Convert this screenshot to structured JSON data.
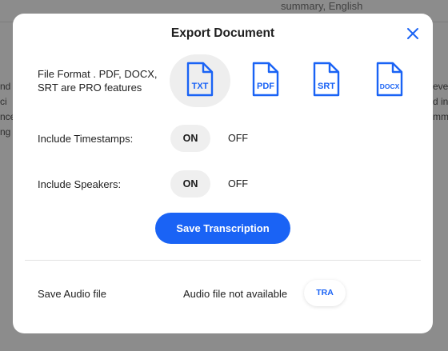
{
  "background": {
    "topbar_text": "summary, English",
    "fragments_left": [
      "nd",
      "ci",
      "nce",
      "ng t"
    ],
    "fragments_right": [
      "evel",
      "d in",
      "mm"
    ]
  },
  "modal": {
    "title": "Export Document",
    "close_icon": "close-icon",
    "file_format": {
      "label": "File Format . PDF, DOCX, SRT are PRO features",
      "options": [
        {
          "label": "TXT",
          "selected": true
        },
        {
          "label": "PDF",
          "selected": false
        },
        {
          "label": "SRT",
          "selected": false
        },
        {
          "label": "DOCX",
          "selected": false
        }
      ]
    },
    "timestamps": {
      "label": "Include Timestamps:",
      "on": "ON",
      "off": "OFF"
    },
    "speakers": {
      "label": "Include Speakers:",
      "on": "ON",
      "off": "OFF"
    },
    "save_button": "Save Transcription",
    "audio": {
      "label": "Save Audio file",
      "status": "Audio file not available",
      "button": "TRA"
    }
  },
  "colors": {
    "accent": "#1a63f5",
    "selected_bg": "#eeeeee",
    "toggle_bg": "#efefef"
  }
}
